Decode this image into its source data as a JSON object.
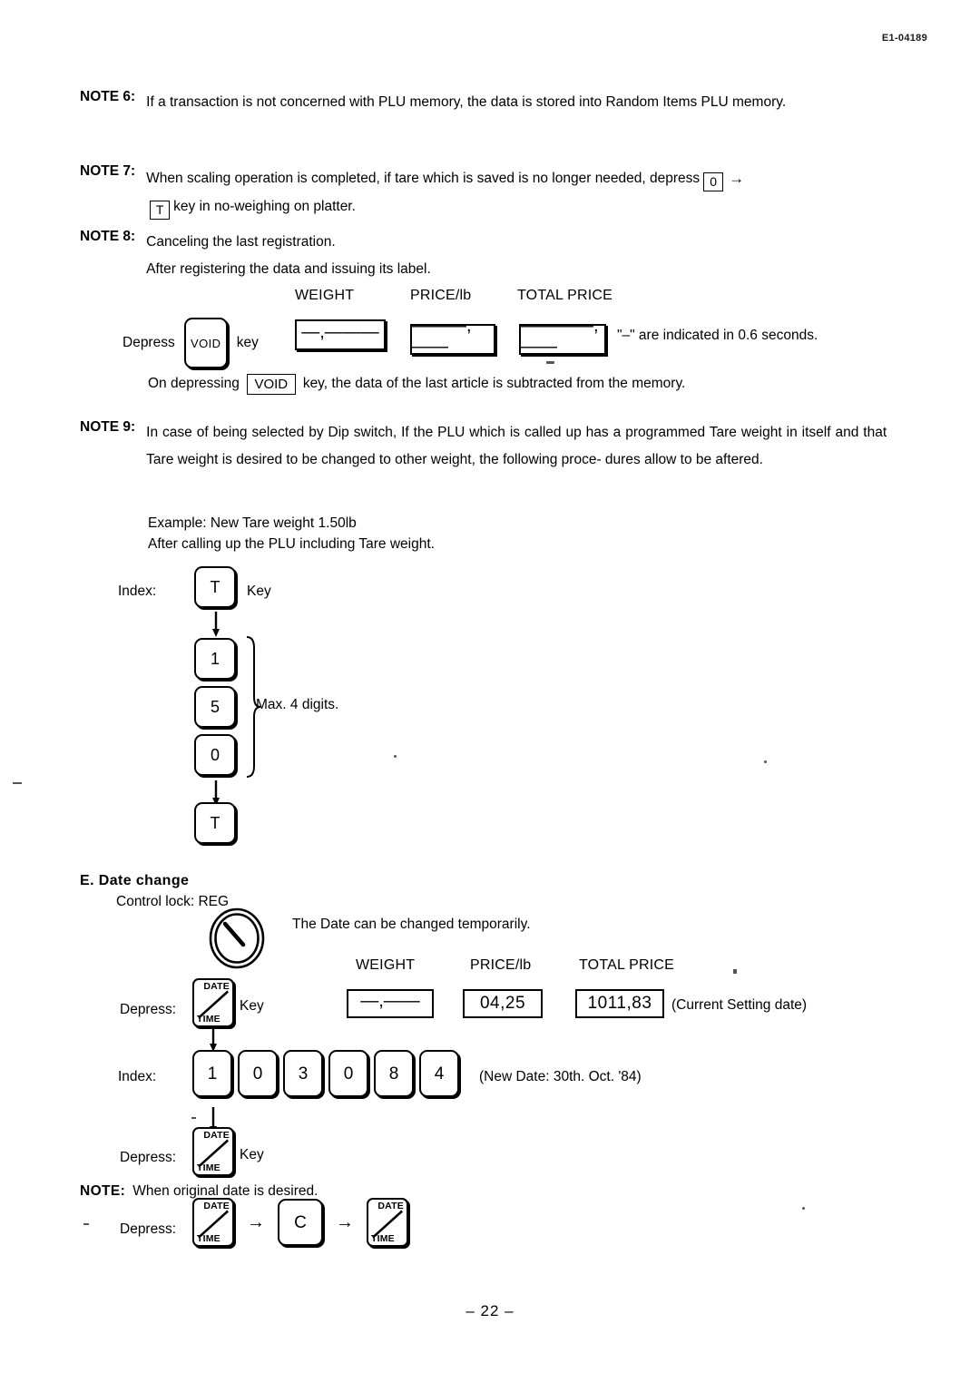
{
  "header": {
    "doc_code": "E1-04189"
  },
  "footer": {
    "page_number": "– 22 –"
  },
  "notes": {
    "note6": {
      "label": "NOTE 6:",
      "text": "If a transaction is not concerned with PLU memory, the data is stored into Random Items PLU memory."
    },
    "note7": {
      "label": "NOTE 7:",
      "line1_pre": "When scaling operation is completed, if tare which is saved is no longer needed, depress",
      "key_zero": "0",
      "arrow": "→",
      "key_t": "T",
      "line2_post": "key in no-weighing on platter."
    },
    "note8": {
      "label": "NOTE 8:",
      "line1": "Canceling the last registration.",
      "line2": "After registering the data and issuing its label.",
      "depress_label": "Depress",
      "key_void": "VOID",
      "key_word": "key",
      "columns": [
        "WEIGHT",
        "PRICE/lb",
        "TOTAL PRICE"
      ],
      "displays": [
        "—,———",
        "———,——",
        "————,——"
      ],
      "trailing_text": "\"–\" are indicated in 0.6 seconds.",
      "closing_pre": "On depressing",
      "closing_key": "VOID",
      "closing_post": "key, the data of the last article is subtracted from the memory."
    },
    "note9": {
      "label": "NOTE 9:",
      "text": "In case of being selected by Dip switch, If the PLU which is called up has a programmed Tare weight in itself and that Tare weight is desired to be changed to other weight, the following proce- dures allow to be aftered.",
      "example_line1": "Example: New Tare weight 1.50lb",
      "example_line2": "After calling up the PLU including Tare weight.",
      "index_label": "Index:",
      "key_t_first": "T",
      "key_word": "Key",
      "digit_keys": [
        "1",
        "5",
        "0"
      ],
      "brace_label": "Max. 4 digits.",
      "key_t_last": "T"
    }
  },
  "section_e": {
    "heading": "E. Date change",
    "control_lock": "Control lock: REG",
    "dial_icon": "control-lock-dial-icon",
    "description": "The Date can be changed temporarily.",
    "columns": [
      "WEIGHT",
      "PRICE/lb",
      "TOTAL PRICE"
    ],
    "depress_label": "Depress:",
    "key_datetime_top": "DATE",
    "key_datetime_bottom": "TIME",
    "key_word": "Key",
    "displays": [
      "—,——",
      "04,25",
      "1011,83"
    ],
    "display_caption": "(Current Setting date)",
    "index_label": "Index:",
    "index_digits": [
      "1",
      "0",
      "3",
      "0",
      "8",
      "4"
    ],
    "index_caption": "(New Date: 30th. Oct. '84)",
    "depress2_label": "Depress:",
    "note": {
      "label": "NOTE:",
      "text": "When original date is desired.",
      "depress_label": "Depress:",
      "sequence": [
        "DATE/TIME",
        "C",
        "DATE/TIME"
      ],
      "arrow": "→",
      "c_key": "C"
    }
  }
}
